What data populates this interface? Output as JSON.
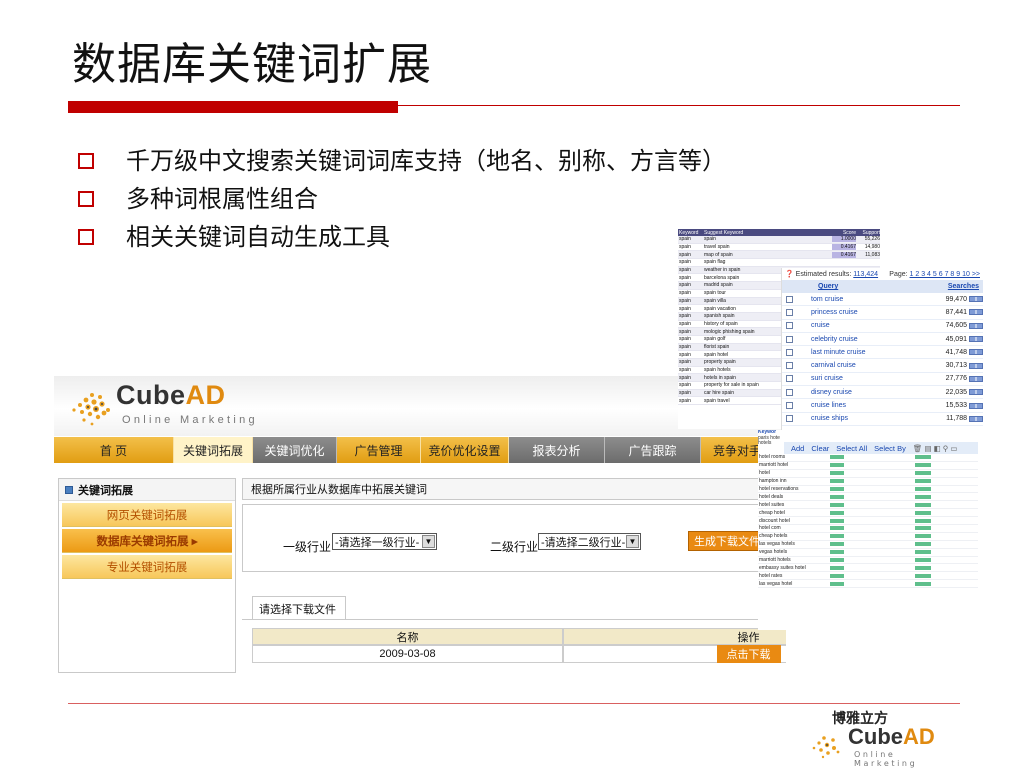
{
  "slide": {
    "title": "数据库关键词扩展",
    "bullets": [
      "千万级中文搜索关键词词库支持（地名、别称、方言等）",
      "多种词根属性组合",
      "相关关键词自动生成工具"
    ],
    "footer_cn": "博雅立方",
    "footer_brand": "CubeAD",
    "footer_sub": "Online Marketing",
    "accent_color": "#c00000"
  },
  "app": {
    "brand": "CubeAD",
    "brand_sub": "Online Marketing",
    "nav": [
      "首 页",
      "关键词拓展",
      "关键词优化",
      "广告管理",
      "竞价优化设置",
      "报表分析",
      "广告跟踪",
      "竞争对手分"
    ],
    "sidebar": {
      "title": "关键词拓展",
      "items": [
        "网页关键词拓展",
        "数据库关键词拓展 ▸",
        "专业关键词拓展"
      ]
    },
    "caption": "根据所属行业从数据库中拓展关键词",
    "filter": {
      "level1_label": "一级行业",
      "level1_value": "-请选择一级行业-",
      "level2_label": "二级行业",
      "level2_value": "-请选择二级行业-",
      "generate": "生成下载文件"
    },
    "tab": "请选择下载文件",
    "table": {
      "headers": [
        "名称",
        "操作"
      ],
      "rows": [
        {
          "name": "2009-03-08",
          "action": "点击下载"
        }
      ]
    }
  },
  "keyword_table": {
    "headers": [
      "Keyword",
      "Suggest Keyword",
      "Score",
      "Support"
    ],
    "rows": [
      [
        "spain",
        "spain",
        "1.0000",
        "55,226"
      ],
      [
        "spain",
        "travel spain",
        "0.4167",
        "14,980"
      ],
      [
        "spain",
        "map of spain",
        "0.4167",
        "11,083"
      ],
      [
        "spain",
        "spain flag",
        "",
        ""
      ],
      [
        "spain",
        "weather in spain",
        "",
        ""
      ],
      [
        "spain",
        "barcelona spain",
        "",
        ""
      ],
      [
        "spain",
        "madrid spain",
        "",
        ""
      ],
      [
        "spain",
        "spain tour",
        "",
        ""
      ],
      [
        "spain",
        "spain villa",
        "",
        ""
      ],
      [
        "spain",
        "spain vacation",
        "",
        ""
      ],
      [
        "spain",
        "spanish spain",
        "",
        ""
      ],
      [
        "spain",
        "history of spain",
        "",
        ""
      ],
      [
        "spain",
        "mologic phishing spain",
        "",
        ""
      ],
      [
        "spain",
        "spain golf",
        "",
        ""
      ],
      [
        "spain",
        "florist spain",
        "",
        ""
      ],
      [
        "spain",
        "spain hotel",
        "",
        ""
      ],
      [
        "spain",
        "property spain",
        "",
        ""
      ],
      [
        "spain",
        "spain hotels",
        "",
        ""
      ],
      [
        "spain",
        "hotels in spain",
        "",
        ""
      ],
      [
        "spain",
        "property for sale in spain",
        "",
        ""
      ],
      [
        "spain",
        "car hire spain",
        "",
        ""
      ],
      [
        "spain",
        "spain travel",
        "",
        ""
      ]
    ]
  },
  "search_panel": {
    "estimated": "Estimated results:",
    "count": "113,424",
    "page_label": "Page:",
    "pages": "1 2 3 4 5 6 7 8 9 10 >>",
    "query_header": "Query",
    "searches_header": "Searches",
    "rows": [
      [
        "tom cruise",
        "99,470"
      ],
      [
        "princess cruise",
        "87,441"
      ],
      [
        "cruise",
        "74,605"
      ],
      [
        "celebrity cruise",
        "45,091"
      ],
      [
        "last minute cruise",
        "41,748"
      ],
      [
        "carnival cruise",
        "30,713"
      ],
      [
        "suri cruise",
        "27,776"
      ],
      [
        "disney cruise",
        "22,035"
      ],
      [
        "cruise lines",
        "15,533"
      ],
      [
        "cruise ships",
        "11,788"
      ]
    ]
  },
  "add_clear": {
    "left_label": "Keywor",
    "left_lines": [
      "paris hote",
      "hotels"
    ],
    "buttons": [
      "Add",
      "Clear",
      "Select All",
      "Select By"
    ],
    "rows": [
      "hotel rooms",
      "marriott hotel",
      "hotel",
      "hampton inn",
      "hotel reservations",
      "hotel deals",
      "hotel suites",
      "cheap hotel",
      "discount hotel",
      "hotel com",
      "cheap hotels",
      "las vegas hotels",
      "vegas hotels",
      "marriott hotels",
      "embassy suites hotel",
      "hotel rates",
      "las vegas hotel"
    ]
  }
}
